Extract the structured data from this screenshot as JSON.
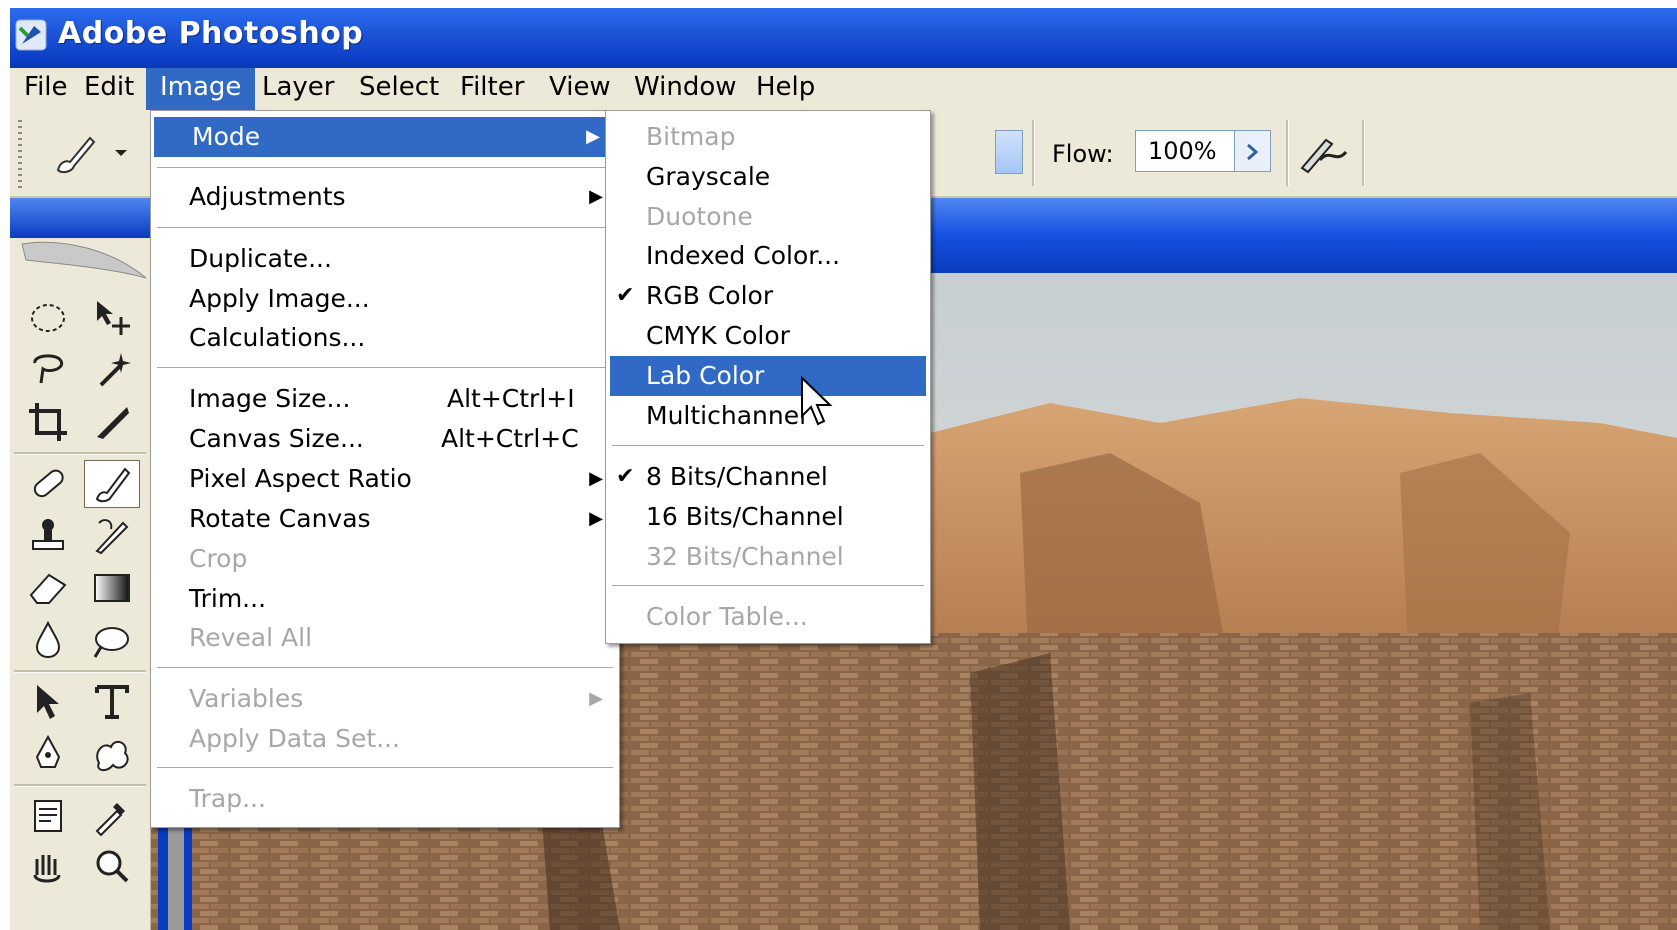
{
  "window": {
    "title": "Adobe Photoshop"
  },
  "menubar": {
    "items": [
      "File",
      "Edit",
      "Image",
      "Layer",
      "Select",
      "Filter",
      "View",
      "Window",
      "Help"
    ],
    "active": "Image"
  },
  "options_bar": {
    "flow_label": "Flow:",
    "flow_value": "100%"
  },
  "image_menu": {
    "mode": "Mode",
    "adjustments": "Adjustments",
    "duplicate": "Duplicate...",
    "apply_image": "Apply Image...",
    "calculations": "Calculations...",
    "image_size": "Image Size...",
    "image_size_shortcut": "Alt+Ctrl+I",
    "canvas_size": "Canvas Size...",
    "canvas_size_shortcut": "Alt+Ctrl+C",
    "pixel_aspect_ratio": "Pixel Aspect Ratio",
    "rotate_canvas": "Rotate Canvas",
    "crop": "Crop",
    "trim": "Trim...",
    "reveal_all": "Reveal All",
    "variables": "Variables",
    "apply_data_set": "Apply Data Set...",
    "trap": "Trap..."
  },
  "mode_menu": {
    "bitmap": "Bitmap",
    "grayscale": "Grayscale",
    "duotone": "Duotone",
    "indexed_color": "Indexed Color...",
    "rgb_color": "RGB Color",
    "cmyk_color": "CMYK Color",
    "lab_color": "Lab Color",
    "multichannel": "Multichannel",
    "bits8": "8 Bits/Channel",
    "bits16": "16 Bits/Channel",
    "bits32": "32 Bits/Channel",
    "color_table": "Color Table...",
    "check_glyph": "✔",
    "arrow_glyph": "▶"
  },
  "colors": {
    "title_blue": "#0b3fc6",
    "menu_highlight": "#316ac5",
    "disabled_text": "#a7a7a7",
    "chrome": "#ece9d8"
  },
  "icons": [
    "photoshop-logo-icon",
    "brush-icon",
    "airbrush-icon",
    "marquee-icon",
    "move-icon",
    "lasso-icon",
    "magic-wand-icon",
    "crop-icon",
    "slice-icon",
    "healing-brush-icon",
    "brush-tool-icon",
    "clone-stamp-icon",
    "history-brush-icon",
    "eraser-icon",
    "gradient-icon",
    "blur-icon",
    "dodge-icon",
    "path-selection-icon",
    "type-icon",
    "pen-icon",
    "custom-shape-icon",
    "notes-icon",
    "eyedropper-icon",
    "hand-icon",
    "zoom-icon",
    "mouse-pointer-icon"
  ]
}
